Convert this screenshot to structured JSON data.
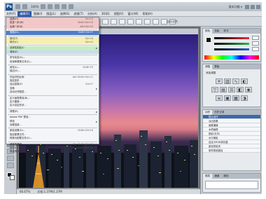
{
  "app": {
    "logo_text": "Ps",
    "title_label": "100%",
    "workspace": "基本功能 ▾"
  },
  "menubar": {
    "items": [
      "文件(F)",
      "编辑(E)",
      "图像(I)",
      "图层(L)",
      "选择(S)",
      "滤镜(T)",
      "分析(A)",
      "3D(D)",
      "视图(V)",
      "窗口(W)",
      "帮助(H)"
    ],
    "active_index": 1
  },
  "options_bar": {
    "text": "自动混合"
  },
  "document": {
    "tab_title": "夜景.jpg @ 66.7% (RGB/8)"
  },
  "statusbar": {
    "zoom": "66.67%",
    "doc_info": "文档:1.37M/1.37M"
  },
  "edit_menu": {
    "items": [
      {
        "label": "还原(O)",
        "shortcut": "Ctrl+Z",
        "hl": "red"
      },
      {
        "label": "前进一步(W)",
        "shortcut": "Shift+Ctrl+Z",
        "hl": "red"
      },
      {
        "label": "后退一步(K)",
        "shortcut": "Alt+Ctrl+Z",
        "hl": "red"
      },
      {
        "sep": true
      },
      {
        "label": "渐隐(D)...",
        "shortcut": "Shift+Ctrl+F",
        "hl": "blue"
      },
      {
        "sep": true
      },
      {
        "label": "剪切(T)",
        "shortcut": "Ctrl+X",
        "hl": "yellow"
      },
      {
        "label": "拷贝(C)",
        "shortcut": "Ctrl+C",
        "hl": "yellow"
      },
      {
        "sep": true
      },
      {
        "label": "选择性粘贴(I)",
        "shortcut": "",
        "arrow": true,
        "hl": "green"
      },
      {
        "label": "清除(E)",
        "shortcut": "",
        "hl": "cyan"
      },
      {
        "sep": true
      },
      {
        "label": "拼写检查(H)...",
        "shortcut": ""
      },
      {
        "label": "查找和替换文本(X)...",
        "shortcut": ""
      },
      {
        "sep": true
      },
      {
        "label": "填充(L)...",
        "shortcut": "Shift+F5"
      },
      {
        "label": "描边(S)...",
        "shortcut": ""
      },
      {
        "sep": true
      },
      {
        "label": "内容识别比例",
        "shortcut": "Alt+Shift+Ctrl+C"
      },
      {
        "label": "操控变形",
        "shortcut": ""
      },
      {
        "label": "自由变换(F)",
        "shortcut": "Ctrl+T"
      },
      {
        "label": "变换",
        "shortcut": "",
        "arrow": true
      },
      {
        "label": "自动对齐图层...",
        "shortcut": ""
      },
      {
        "sep": true
      },
      {
        "label": "定义画笔预设(B)...",
        "shortcut": ""
      },
      {
        "label": "定义图案...",
        "shortcut": ""
      },
      {
        "label": "定义自定形状...",
        "shortcut": ""
      },
      {
        "sep": true
      },
      {
        "label": "清理(R)",
        "shortcut": "",
        "arrow": true
      },
      {
        "sep": true
      },
      {
        "label": "Adobe PDF 预设...",
        "shortcut": ""
      },
      {
        "label": "预设",
        "shortcut": "",
        "arrow": true
      },
      {
        "label": "远程连接...",
        "shortcut": ""
      },
      {
        "sep": true
      },
      {
        "label": "颜色设置(G)...",
        "shortcut": "Shift+Ctrl+K"
      },
      {
        "label": "指定配置文件...",
        "shortcut": ""
      },
      {
        "label": "转换为配置文件(V)...",
        "shortcut": ""
      },
      {
        "sep": true
      },
      {
        "label": "键盘快捷键...",
        "shortcut": "Alt+Shift+Ctrl+K"
      },
      {
        "label": "菜单(U)...",
        "shortcut": "Alt+Shift+Ctrl+M"
      },
      {
        "label": "首选项(N)",
        "shortcut": "",
        "arrow": true
      }
    ]
  },
  "panels": {
    "color_tabs": [
      "颜色",
      "色板",
      "样式"
    ],
    "adjust_tabs": [
      "调整",
      "蒙版"
    ],
    "adjust_title": "添加调整",
    "actions_tabs": [
      "动作",
      "历史记录"
    ],
    "actions": [
      "默认动作",
      "淡出效果",
      "画框通道",
      "木质画框",
      "投影(文字)",
      "水中倒影",
      "自定义RGB到灰度",
      "熔化的铅块",
      "制作剪贴路径"
    ],
    "actions_selected": 0,
    "layers_tabs": [
      "图层",
      "通道",
      "路径"
    ],
    "colors": {
      "red": "#e8303a",
      "green": "#35b24a",
      "blue": "#2c5fd6"
    }
  }
}
